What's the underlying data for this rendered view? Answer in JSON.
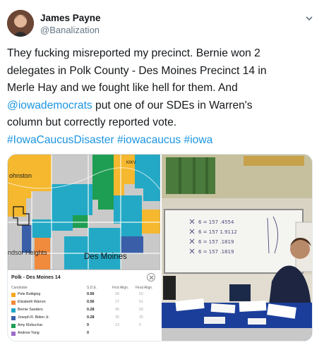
{
  "author": {
    "display_name": "James Payne",
    "handle": "@Banalization"
  },
  "tweet": {
    "lines": [
      [
        {
          "t": "They fucking misreported my precinct. Bernie won 2",
          "link": false
        }
      ],
      [
        {
          "t": "delegates in Polk County - Des Moines Precinct 14 in",
          "link": false
        }
      ],
      [
        {
          "t": "Merle Hay and we fought like hell for them. And",
          "link": false
        }
      ],
      [
        {
          "t": "@iowademocrats",
          "link": true
        },
        {
          "t": " put one of our SDEs in Warren's",
          "link": false
        }
      ],
      [
        {
          "t": "column but correctly reported vote.",
          "link": false
        }
      ],
      [
        {
          "t": "#IowaCaucusDisaster",
          "link": true
        },
        {
          "t": " ",
          "link": false
        },
        {
          "t": "#iowacaucus",
          "link": true
        },
        {
          "t": " ",
          "link": false
        },
        {
          "t": "#iowa",
          "link": true
        }
      ]
    ]
  },
  "media": {
    "map": {
      "labels": {
        "johnston": "ohnston",
        "windsor_heights": "ndsor Heights",
        "des_moines": "Des Moines",
        "road": "KIKV"
      },
      "card": {
        "title": "Polk - Des Moines 14",
        "headers": {
          "candidate": "Candidate",
          "sde": "S.D.E.",
          "first": "First Align.",
          "final": "Final Align."
        },
        "rows": [
          {
            "name": "Pete Buttigieg",
            "color": "#f5a623",
            "sde": "0.56",
            "first": "30",
            "final": "52"
          },
          {
            "name": "Elizabeth Warren",
            "color": "#f08a3c",
            "sde": "0.56",
            "first": "27",
            "final": "51"
          },
          {
            "name": "Bernie Sanders",
            "color": "#22a6c6",
            "sde": "0.28",
            "first": "46",
            "final": "50"
          },
          {
            "name": "Joseph R. Biden Jr.",
            "color": "#3a5fa8",
            "sde": "0.28",
            "first": "26",
            "final": "25"
          },
          {
            "name": "Amy Klobuchar",
            "color": "#1e9e52",
            "sde": "0",
            "first": "13",
            "final": "0"
          },
          {
            "name": "Andrew Yang",
            "color": "#9c6bc6",
            "sde": "0",
            "first": "",
            "final": ""
          }
        ]
      }
    },
    "photo": {
      "whiteboard_lines": [
        "x 6 = 157 .4554",
        "x 6 = 157 1.9112",
        "x 6 = 157 .1819",
        "x 6 = 157 .1819"
      ]
    }
  },
  "colors": {
    "link": "#1b95e0",
    "handle": "#657786",
    "buttigieg": "#f5a623",
    "sanders": "#22a6c6",
    "klobuchar": "#1e9e52",
    "warren": "#f08a3c"
  }
}
